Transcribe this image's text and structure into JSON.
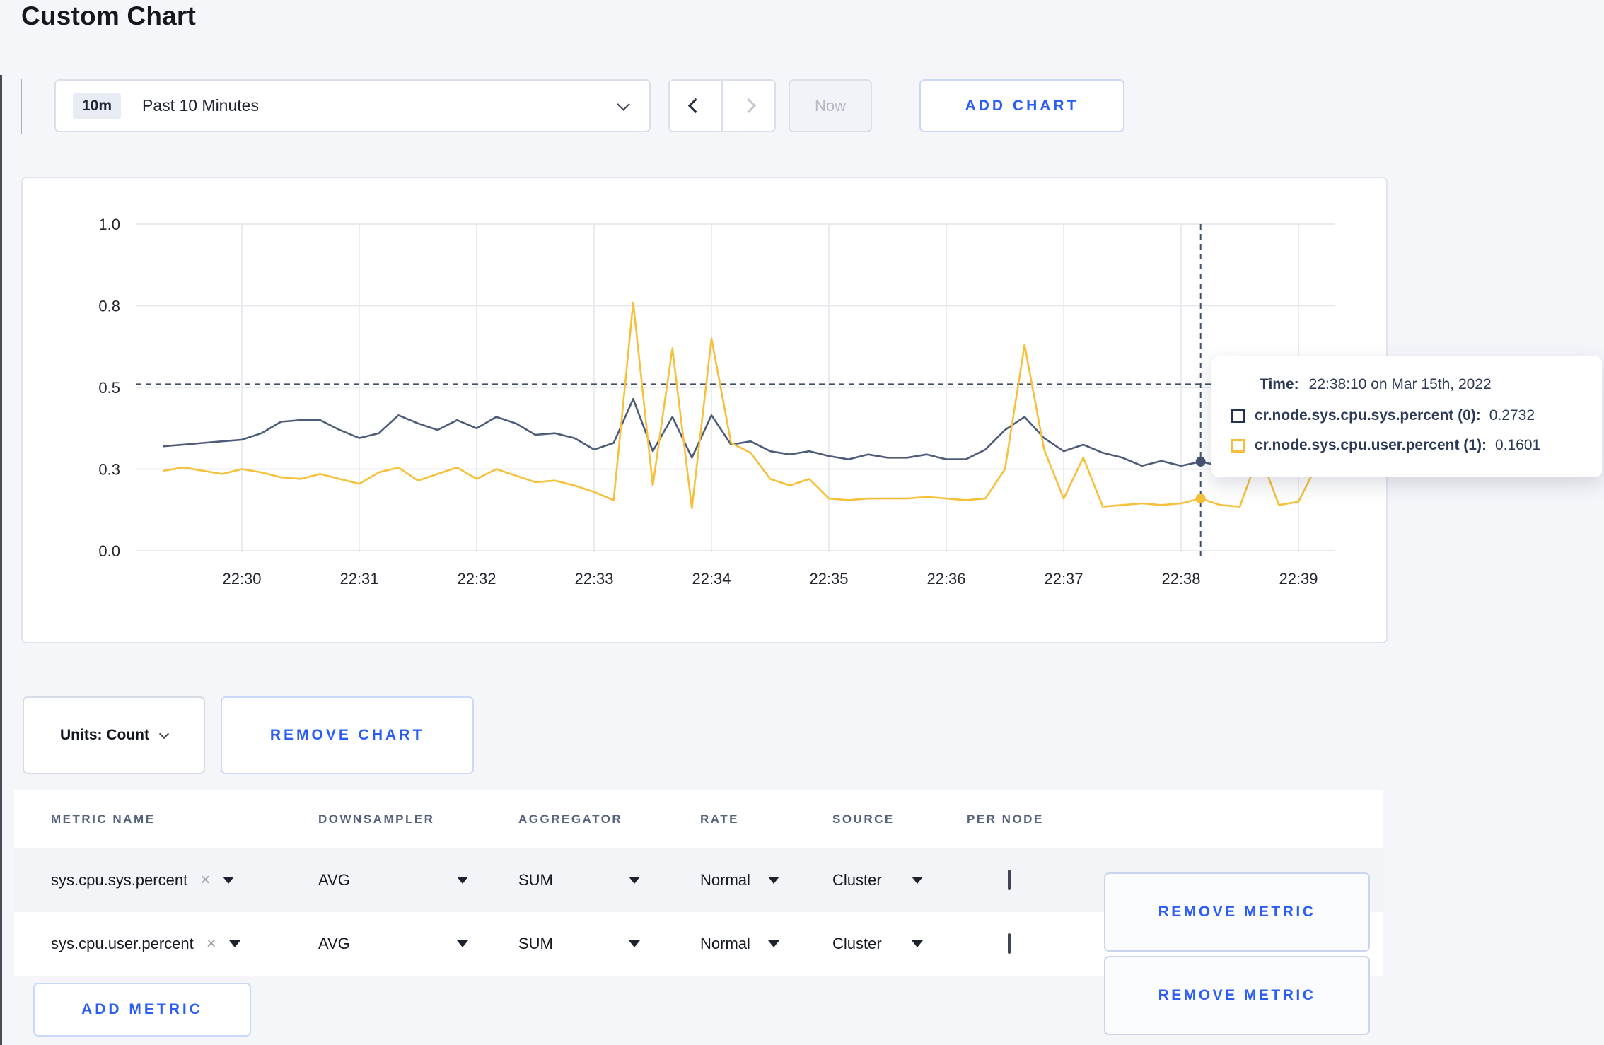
{
  "page": {
    "title": "Custom Chart",
    "background": "#f5f6fa",
    "accent_blue": "#2b5cf6"
  },
  "toolbar": {
    "time_window_badge": "10m",
    "time_window_label": "Past 10 Minutes",
    "now_label": "Now",
    "add_chart_label": "ADD CHART"
  },
  "icons": {
    "close_x": "×"
  },
  "chart_data": {
    "type": "line",
    "title": "",
    "x_axis": {
      "tick_labels": [
        "22:30",
        "22:31",
        "22:32",
        "22:33",
        "22:34",
        "22:35",
        "22:36",
        "22:37",
        "22:38",
        "22:39"
      ],
      "start_time": "22:29:20",
      "step_seconds": 10
    },
    "y_axis": {
      "range": [
        0,
        1
      ],
      "ticks": [
        {
          "label": "0.0",
          "value": 0
        },
        {
          "label": "0.3",
          "value": 0.25
        },
        {
          "label": "0.5",
          "value": 0.5
        },
        {
          "label": "0.8",
          "value": 0.75
        },
        {
          "label": "1.0",
          "value": 1
        }
      ]
    },
    "grid": true,
    "legend_position": "tooltip",
    "series": [
      {
        "name": "cr.node.sys.cpu.sys.percent (0)",
        "color": "#4d5c79",
        "values": [
          0.32,
          0.325,
          0.33,
          0.335,
          0.34,
          0.36,
          0.395,
          0.4,
          0.4,
          0.37,
          0.345,
          0.36,
          0.415,
          0.39,
          0.37,
          0.4,
          0.375,
          0.41,
          0.39,
          0.355,
          0.36,
          0.345,
          0.31,
          0.33,
          0.465,
          0.305,
          0.41,
          0.285,
          0.415,
          0.325,
          0.335,
          0.305,
          0.295,
          0.305,
          0.29,
          0.28,
          0.295,
          0.285,
          0.285,
          0.295,
          0.28,
          0.28,
          0.31,
          0.37,
          0.41,
          0.345,
          0.305,
          0.325,
          0.3,
          0.285,
          0.26,
          0.275,
          0.26,
          0.2732,
          0.26,
          0.27,
          0.3,
          0.31,
          0.29,
          0.3,
          0.305
        ]
      },
      {
        "name": "cr.node.sys.cpu.user.percent (1)",
        "color": "#f6c03a",
        "values": [
          0.245,
          0.255,
          0.245,
          0.235,
          0.25,
          0.24,
          0.225,
          0.22,
          0.235,
          0.22,
          0.205,
          0.24,
          0.255,
          0.215,
          0.235,
          0.255,
          0.22,
          0.25,
          0.23,
          0.21,
          0.215,
          0.2,
          0.18,
          0.155,
          0.76,
          0.2,
          0.62,
          0.13,
          0.65,
          0.33,
          0.3,
          0.22,
          0.2,
          0.22,
          0.16,
          0.155,
          0.16,
          0.16,
          0.16,
          0.165,
          0.16,
          0.155,
          0.16,
          0.25,
          0.63,
          0.31,
          0.16,
          0.285,
          0.135,
          0.14,
          0.145,
          0.14,
          0.145,
          0.1601,
          0.14,
          0.135,
          0.3,
          0.14,
          0.15,
          0.27,
          0.235
        ]
      }
    ],
    "crosshair": {
      "time": "22:38:10",
      "minutes_after_2230": 8.1667,
      "h_guide_value": 0.51,
      "point_values": [
        0.2732,
        0.1601
      ]
    }
  },
  "tooltip": {
    "time_label": "Time:",
    "time_value": "22:38:10 on Mar 15th, 2022",
    "rows": [
      {
        "name": "cr.node.sys.cpu.sys.percent (0):",
        "value": "0.2732",
        "swatch_color": "#24344d"
      },
      {
        "name": "cr.node.sys.cpu.user.percent (1):",
        "value": "0.1601",
        "swatch_color": "#f6bf3a"
      }
    ]
  },
  "units": {
    "label": "Units: Count",
    "remove_chart_label": "REMOVE CHART"
  },
  "metrics_table": {
    "headers": [
      "METRIC NAME",
      "DOWNSAMPLER",
      "AGGREGATOR",
      "RATE",
      "SOURCE",
      "PER NODE"
    ],
    "rows": [
      {
        "metric_name": "sys.cpu.sys.percent",
        "downsampler": "AVG",
        "aggregator": "SUM",
        "rate": "Normal",
        "source": "Cluster",
        "per_node_checked": false,
        "remove_label": "REMOVE METRIC"
      },
      {
        "metric_name": "sys.cpu.user.percent",
        "downsampler": "AVG",
        "aggregator": "SUM",
        "rate": "Normal",
        "source": "Cluster",
        "per_node_checked": false,
        "remove_label": "REMOVE METRIC"
      }
    ],
    "add_metric_label": "ADD METRIC"
  }
}
